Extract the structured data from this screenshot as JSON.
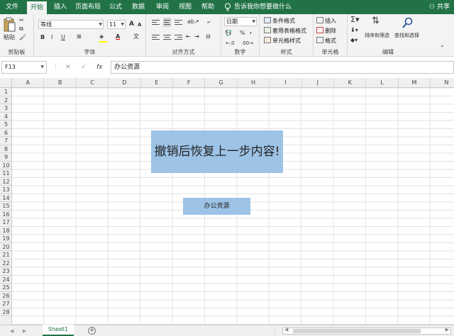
{
  "tabs": [
    {
      "label": "文件",
      "active": false
    },
    {
      "label": "开始",
      "active": true
    },
    {
      "label": "插入",
      "active": false
    },
    {
      "label": "页面布局",
      "active": false
    },
    {
      "label": "公式",
      "active": false
    },
    {
      "label": "数据",
      "active": false
    },
    {
      "label": "审阅",
      "active": false
    },
    {
      "label": "视图",
      "active": false
    },
    {
      "label": "帮助",
      "active": false
    }
  ],
  "tell_me": "告诉我你想要做什么",
  "share": "共享",
  "ribbon": {
    "clipboard": {
      "label": "剪贴板",
      "paste": "粘贴"
    },
    "font": {
      "label": "字体",
      "name": "等线",
      "size": "11",
      "bold": "B",
      "italic": "I",
      "underline": "U",
      "grow": "A",
      "shrink": "A",
      "font_color": "A"
    },
    "alignment": {
      "label": "对齐方式"
    },
    "number": {
      "label": "数字",
      "format": "日期",
      "percent": "%",
      "comma": ","
    },
    "styles": {
      "label": "样式",
      "conditional": "条件格式",
      "table": "套用表格格式",
      "cell": "单元格样式"
    },
    "cells": {
      "label": "单元格",
      "insert": "插入",
      "delete": "删除",
      "format": "格式"
    },
    "editing": {
      "label": "编辑",
      "sort": "排序和筛选",
      "find": "查找和选择"
    }
  },
  "formula_bar": {
    "name_box": "F13",
    "cancel": "✕",
    "confirm": "✓",
    "fx": "fx",
    "content": "办公资源"
  },
  "columns": [
    "A",
    "B",
    "C",
    "D",
    "E",
    "F",
    "G",
    "H",
    "I",
    "J",
    "K",
    "L",
    "M",
    "N"
  ],
  "rows": [
    "1",
    "2",
    "3",
    "4",
    "5",
    "6",
    "7",
    "8",
    "9",
    "10",
    "11",
    "12",
    "13",
    "14",
    "15",
    "16",
    "17",
    "18",
    "19",
    "20",
    "21",
    "22",
    "23",
    "24",
    "25",
    "26",
    "27",
    "28"
  ],
  "shapes": {
    "big_text": "撤销后恢复上一步内容!",
    "small_text": "办公资源"
  },
  "sheets": [
    {
      "name": "Sheet1",
      "active": true
    }
  ],
  "colors": {
    "brand": "#217346",
    "box_fill": "#9dc3e6"
  }
}
